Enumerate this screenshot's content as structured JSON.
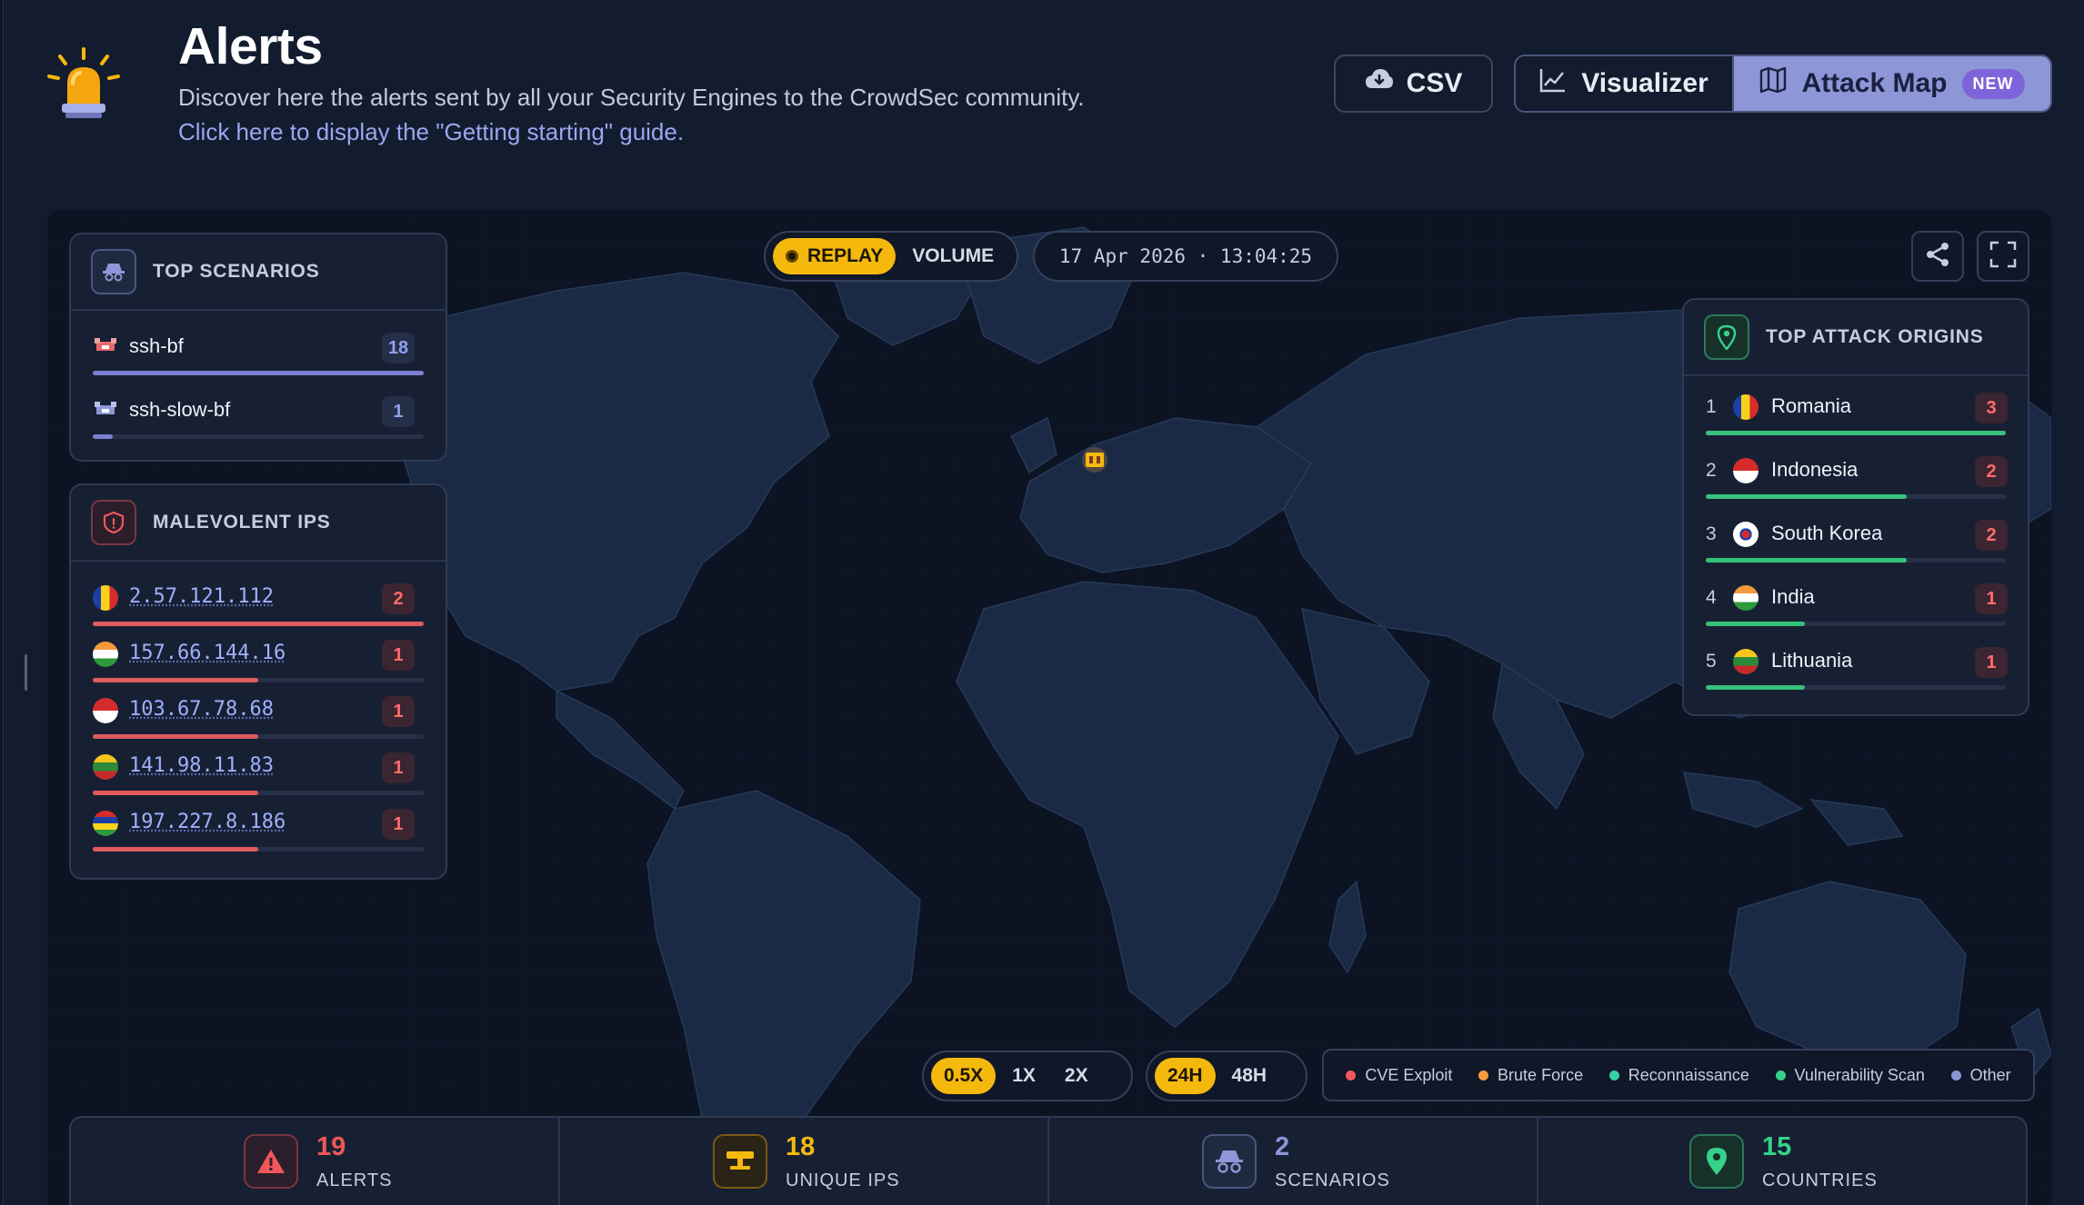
{
  "header": {
    "title": "Alerts",
    "subtitle": "Discover here the alerts sent by all your Security Engines to the CrowdSec community.",
    "guide_link": "Click here to display the \"Getting starting\" guide."
  },
  "actions": {
    "csv_label": "CSV",
    "visualizer_label": "Visualizer",
    "attack_map_label": "Attack Map",
    "new_badge": "NEW"
  },
  "map": {
    "mode_toggle": {
      "replay": "REPLAY",
      "volume": "VOLUME"
    },
    "timestamp": "17 Apr 2026 · 13:04:25",
    "speed": {
      "options": [
        "0.5X",
        "1X",
        "2X"
      ],
      "selected": "0.5X"
    },
    "range": {
      "options": [
        "24H",
        "48H"
      ],
      "selected": "24H"
    },
    "legend": [
      {
        "label": "CVE Exploit",
        "color": "#f0575a"
      },
      {
        "label": "Brute Force",
        "color": "#f59a3a"
      },
      {
        "label": "Reconnaissance",
        "color": "#36d2a6"
      },
      {
        "label": "Vulnerability Scan",
        "color": "#36d28a"
      },
      {
        "label": "Other",
        "color": "#8d96d6"
      }
    ]
  },
  "top_scenarios": {
    "title": "TOP SCENARIOS",
    "items": [
      {
        "name": "ssh-bf",
        "count": "18",
        "share": 1.0
      },
      {
        "name": "ssh-slow-bf",
        "count": "1",
        "share": 0.06
      }
    ]
  },
  "malevolent_ips": {
    "title": "MALEVOLENT IPS",
    "items": [
      {
        "ip": "2.57.121.112",
        "count": "2",
        "share": 1.0,
        "flag": "romania"
      },
      {
        "ip": "157.66.144.16",
        "count": "1",
        "share": 0.5,
        "flag": "india"
      },
      {
        "ip": "103.67.78.68",
        "count": "1",
        "share": 0.5,
        "flag": "indonesia"
      },
      {
        "ip": "141.98.11.83",
        "count": "1",
        "share": 0.5,
        "flag": "lithuania"
      },
      {
        "ip": "197.227.8.186",
        "count": "1",
        "share": 0.5,
        "flag": "mauritius"
      }
    ]
  },
  "top_origins": {
    "title": "TOP ATTACK ORIGINS",
    "items": [
      {
        "rank": "1",
        "country": "Romania",
        "count": "3",
        "share": 1.0,
        "flag": "romania"
      },
      {
        "rank": "2",
        "country": "Indonesia",
        "count": "2",
        "share": 0.67,
        "flag": "indonesia"
      },
      {
        "rank": "3",
        "country": "South Korea",
        "count": "2",
        "share": 0.67,
        "flag": "korea"
      },
      {
        "rank": "4",
        "country": "India",
        "count": "1",
        "share": 0.33,
        "flag": "india"
      },
      {
        "rank": "5",
        "country": "Lithuania",
        "count": "1",
        "share": 0.33,
        "flag": "lithuania"
      }
    ]
  },
  "stats": [
    {
      "value": "19",
      "label": "ALERTS",
      "color": "#f0575a",
      "icon": "warning-icon"
    },
    {
      "value": "18",
      "label": "UNIQUE IPS",
      "color": "#f5b90e",
      "icon": "server-icon"
    },
    {
      "value": "2",
      "label": "SCENARIOS",
      "color": "#8d96d6",
      "icon": "spy-icon"
    },
    {
      "value": "15",
      "label": "COUNTRIES",
      "color": "#36d28a",
      "icon": "map-pin-icon"
    }
  ]
}
